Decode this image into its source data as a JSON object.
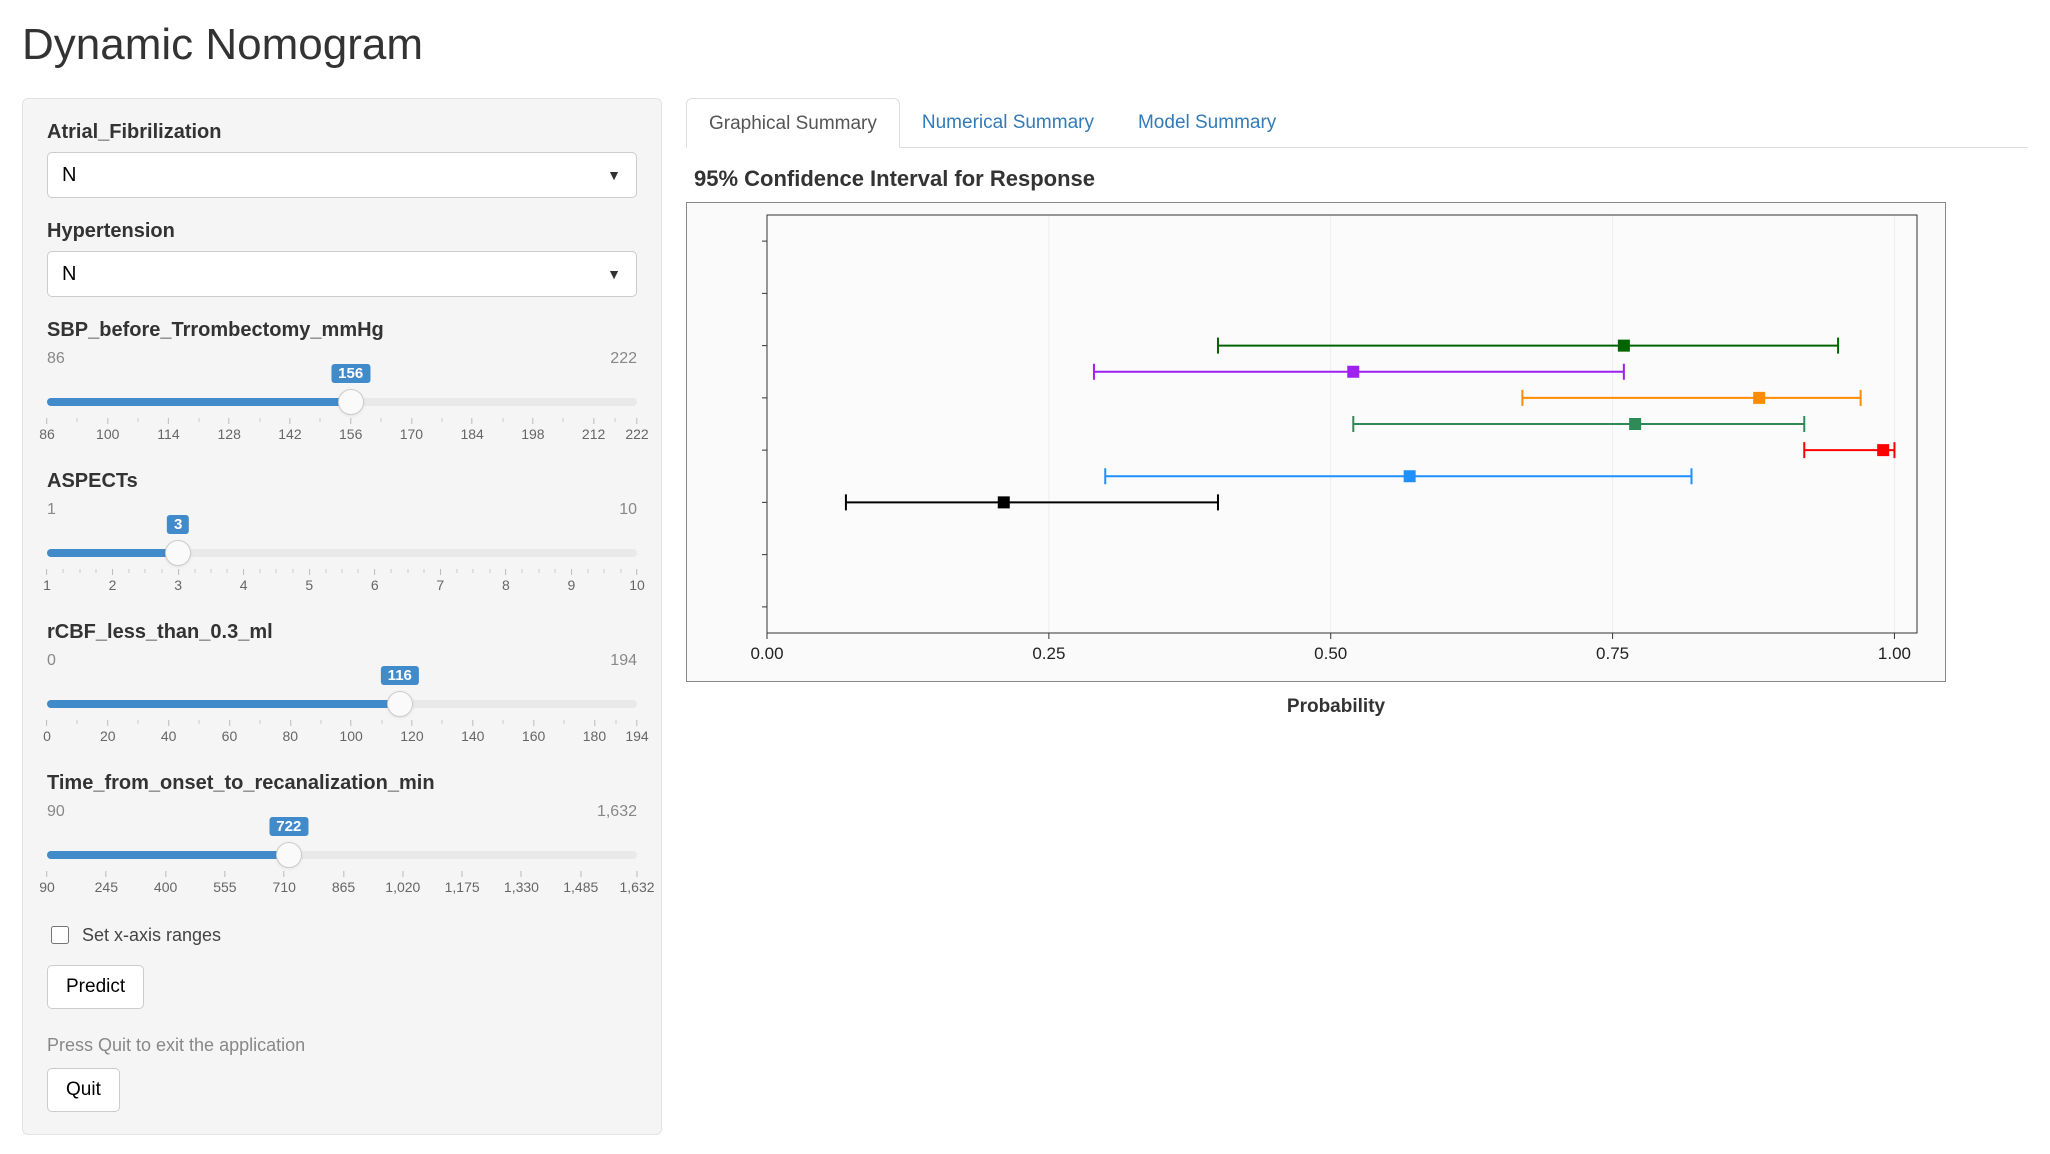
{
  "page": {
    "title": "Dynamic Nomogram"
  },
  "tabs": {
    "items": [
      {
        "label": "Graphical Summary",
        "active": true
      },
      {
        "label": "Numerical Summary",
        "active": false
      },
      {
        "label": "Model Summary",
        "active": false
      }
    ]
  },
  "sidebar": {
    "af": {
      "label": "Atrial_Fibrilization",
      "value": "N"
    },
    "htn": {
      "label": "Hypertension",
      "value": "N"
    },
    "sliders": [
      {
        "id": "sbp",
        "label": "SBP_before_Trrombectomy_mmHg",
        "min": 86,
        "max": 222,
        "value": 156,
        "ticks": [
          86,
          100,
          114,
          128,
          142,
          156,
          170,
          184,
          198,
          212,
          222
        ],
        "minor_each": 1
      },
      {
        "id": "aspects",
        "label": "ASPECTs",
        "min": 1,
        "max": 10,
        "value": 3,
        "ticks": [
          1,
          2,
          3,
          4,
          5,
          6,
          7,
          8,
          9,
          10
        ],
        "minor_each": 3
      },
      {
        "id": "rcbf",
        "label": "rCBF_less_than_0.3_ml",
        "min": 0,
        "max": 194,
        "value": 116,
        "ticks": [
          0,
          20,
          40,
          60,
          80,
          100,
          120,
          140,
          160,
          180,
          194
        ],
        "minor_each": 1
      },
      {
        "id": "onset",
        "label": "Time_from_onset_to_recanalization_min",
        "min": 90,
        "max": 1632,
        "value": 722,
        "ticks": [
          90,
          245,
          400,
          555,
          710,
          865,
          1020,
          1175,
          1330,
          1485,
          1632
        ],
        "tick_labels": [
          "90",
          "245",
          "400",
          "555",
          "710",
          "865",
          "1,020",
          "1,175",
          "1,330",
          "1,485",
          "1,632"
        ],
        "minor_each": 0
      }
    ],
    "checkbox": {
      "label": "Set x-axis ranges",
      "checked": false
    },
    "predict_label": "Predict",
    "quit_help": "Press Quit to exit the application",
    "quit_label": "Quit"
  },
  "chart_data": {
    "type": "errorbar",
    "title": "95% Confidence Interval for Response",
    "xlabel": "Probability",
    "xlim": [
      0,
      1.02
    ],
    "xticks": [
      0.0,
      0.25,
      0.5,
      0.75,
      1.0
    ],
    "xtick_labels": [
      "0.00",
      "0.25",
      "0.50",
      "0.75",
      "1.00"
    ],
    "series": [
      {
        "color": "#006400",
        "low": 0.4,
        "point": 0.76,
        "high": 0.95,
        "row": 6
      },
      {
        "color": "#a020f0",
        "low": 0.29,
        "point": 0.52,
        "high": 0.76,
        "row": 5.5
      },
      {
        "color": "#ff8c00",
        "low": 0.67,
        "point": 0.88,
        "high": 0.97,
        "row": 5
      },
      {
        "color": "#2e8b57",
        "low": 0.52,
        "point": 0.77,
        "high": 0.92,
        "row": 4.5
      },
      {
        "color": "#ff0000",
        "low": 0.92,
        "point": 0.99,
        "high": 1.0,
        "row": 4
      },
      {
        "color": "#1e90ff",
        "low": 0.3,
        "point": 0.57,
        "high": 0.82,
        "row": 3.5
      },
      {
        "color": "#000000",
        "low": 0.07,
        "point": 0.21,
        "high": 0.4,
        "row": 3
      }
    ],
    "rows_total": 8
  }
}
